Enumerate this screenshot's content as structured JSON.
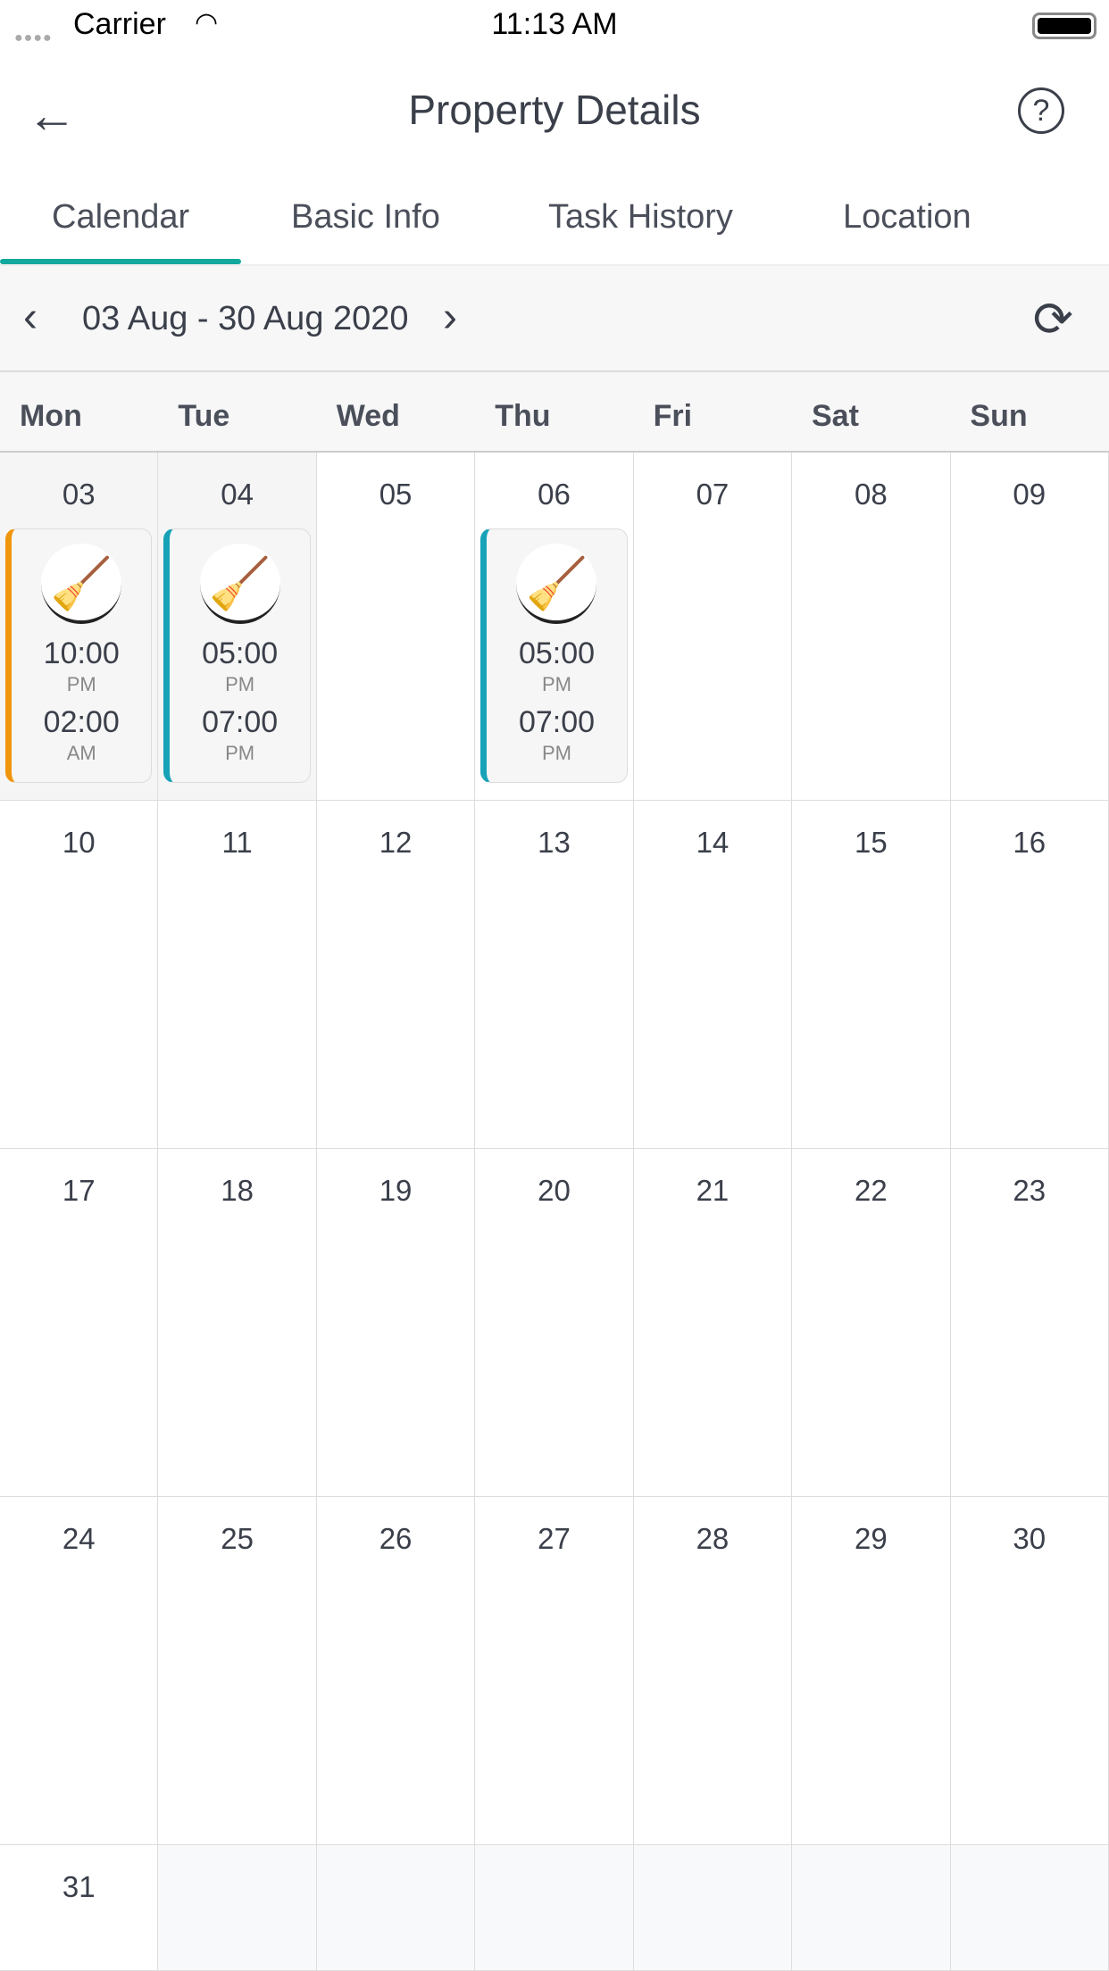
{
  "status_bar": {
    "carrier": "Carrier",
    "time": "11:13 AM"
  },
  "header": {
    "title": "Property Details"
  },
  "tabs": [
    {
      "label": "Calendar",
      "active": true
    },
    {
      "label": "Basic Info"
    },
    {
      "label": "Task History"
    },
    {
      "label": "Location"
    }
  ],
  "date_nav": {
    "range": "03 Aug - 30 Aug 2020"
  },
  "weekdays": [
    "Mon",
    "Tue",
    "Wed",
    "Thu",
    "Fri",
    "Sat",
    "Sun"
  ],
  "colors": {
    "accent": "#12a89d",
    "event_orange": "#f0960e",
    "event_teal": "#17a2b8"
  },
  "days": [
    {
      "day": "03",
      "past": true,
      "event": {
        "color": "#f0960e",
        "start": "10:00",
        "start_ampm": "PM",
        "end": "02:00",
        "end_ampm": "AM",
        "icon": "cleaner-icon"
      }
    },
    {
      "day": "04",
      "past": true,
      "event": {
        "color": "#17a2b8",
        "start": "05:00",
        "start_ampm": "PM",
        "end": "07:00",
        "end_ampm": "PM",
        "icon": "cleaner-icon"
      }
    },
    {
      "day": "05"
    },
    {
      "day": "06",
      "event": {
        "color": "#17a2b8",
        "start": "05:00",
        "start_ampm": "PM",
        "end": "07:00",
        "end_ampm": "PM",
        "icon": "cleaner-icon"
      }
    },
    {
      "day": "07"
    },
    {
      "day": "08"
    },
    {
      "day": "09"
    },
    {
      "day": "10"
    },
    {
      "day": "11"
    },
    {
      "day": "12"
    },
    {
      "day": "13"
    },
    {
      "day": "14"
    },
    {
      "day": "15"
    },
    {
      "day": "16"
    },
    {
      "day": "17"
    },
    {
      "day": "18"
    },
    {
      "day": "19"
    },
    {
      "day": "20"
    },
    {
      "day": "21"
    },
    {
      "day": "22"
    },
    {
      "day": "23"
    },
    {
      "day": "24"
    },
    {
      "day": "25"
    },
    {
      "day": "26"
    },
    {
      "day": "27"
    },
    {
      "day": "28"
    },
    {
      "day": "29"
    },
    {
      "day": "30"
    },
    {
      "day": "31"
    }
  ]
}
